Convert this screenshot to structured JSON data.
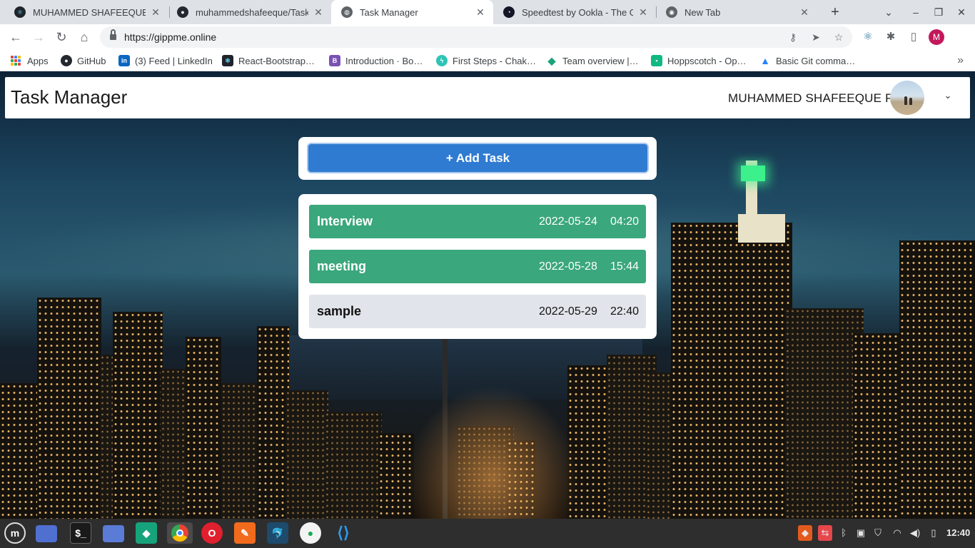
{
  "browser": {
    "tabs": [
      {
        "title": "MUHAMMED SHAFEEQUE P",
        "icon": "react-icon",
        "active": false
      },
      {
        "title": "muhammedshafeeque/Task",
        "icon": "github-icon",
        "active": false
      },
      {
        "title": "Task Manager",
        "icon": "globe-icon",
        "active": true
      },
      {
        "title": "Speedtest by Ookla - The Gl",
        "icon": "speedtest-icon",
        "active": false
      },
      {
        "title": "New Tab",
        "icon": "chrome-icon",
        "active": false
      }
    ],
    "url": "https://gippme.online",
    "profile_initial": "M",
    "bookmarks": [
      {
        "label": "Apps"
      },
      {
        "label": "GitHub"
      },
      {
        "label": "(3) Feed | LinkedIn",
        "badge": "in"
      },
      {
        "label": "React-Bootstrap…"
      },
      {
        "label": "Introduction · Bo…",
        "badge": "B"
      },
      {
        "label": "First Steps - Chak…"
      },
      {
        "label": "Team overview |…"
      },
      {
        "label": "Hoppscotch - Op…"
      },
      {
        "label": "Basic Git comma…"
      }
    ]
  },
  "app": {
    "brand": "Task Manager",
    "user_name": "MUHAMMED SHAFEEQUE P",
    "add_task_label": "+ Add Task",
    "tasks": [
      {
        "name": "Interview",
        "date": "2022-05-24",
        "time": "04:20",
        "status": "done"
      },
      {
        "name": "meeting",
        "date": "2022-05-28",
        "time": "15:44",
        "status": "done"
      },
      {
        "name": "sample",
        "date": "2022-05-29",
        "time": "22:40",
        "status": "pending"
      }
    ]
  },
  "taskbar": {
    "apps": [
      "mint-menu-icon",
      "workspace-icon",
      "terminal-icon",
      "files-icon",
      "gitkraken-icon",
      "chrome-icon",
      "opera-icon",
      "postman-icon",
      "mysql-workbench-icon",
      "mongodb-compass-icon",
      "vscode-icon"
    ],
    "clock": "12:40"
  },
  "colors": {
    "task_done": "#3aa77c",
    "task_pending": "#e1e4ea",
    "add_button": "#2f7bd1"
  }
}
